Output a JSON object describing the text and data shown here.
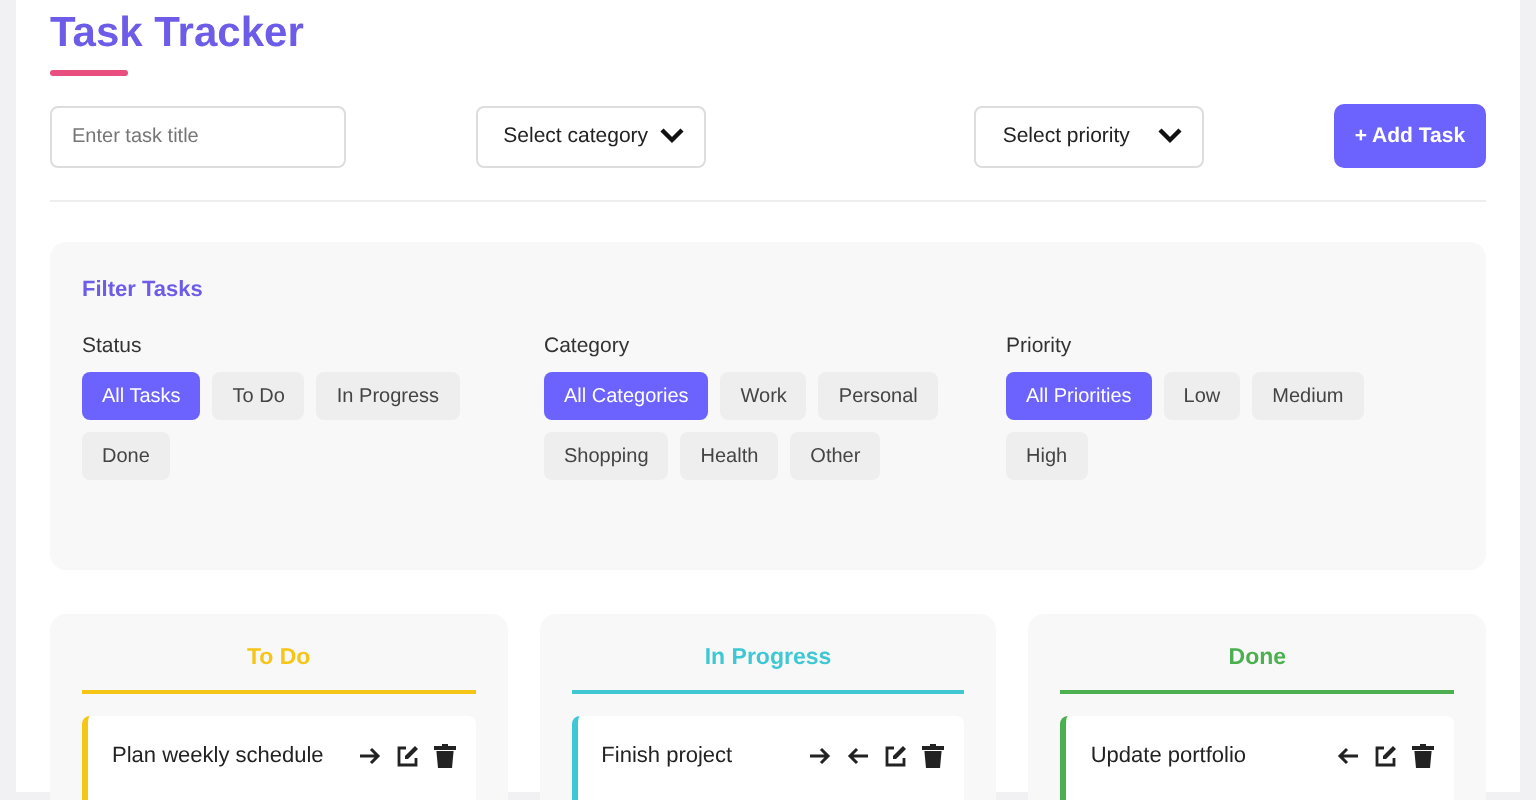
{
  "title": "Task Tracker",
  "form": {
    "title_placeholder": "Enter task title",
    "category": "Select category",
    "priority": "Select priority",
    "add_button": "+ Add Task"
  },
  "filters": {
    "heading": "Filter Tasks",
    "groups": [
      {
        "label": "Status",
        "options": [
          {
            "label": "All Tasks",
            "selected": true
          },
          {
            "label": "To Do",
            "selected": false
          },
          {
            "label": "In Progress",
            "selected": false
          },
          {
            "label": "Done",
            "selected": false
          }
        ]
      },
      {
        "label": "Category",
        "options": [
          {
            "label": "All Categories",
            "selected": true
          },
          {
            "label": "Work",
            "selected": false
          },
          {
            "label": "Personal",
            "selected": false
          },
          {
            "label": "Shopping",
            "selected": false
          },
          {
            "label": "Health",
            "selected": false
          },
          {
            "label": "Other",
            "selected": false
          }
        ]
      },
      {
        "label": "Priority",
        "options": [
          {
            "label": "All Priorities",
            "selected": true
          },
          {
            "label": "Low",
            "selected": false
          },
          {
            "label": "Medium",
            "selected": false
          },
          {
            "label": "High",
            "selected": false
          }
        ]
      }
    ]
  },
  "columns": [
    {
      "title": "To Do",
      "color": "#f5c518",
      "tasks": [
        {
          "title": "Plan weekly schedule",
          "actions": [
            {
              "kind": "right"
            },
            {
              "kind": "edit"
            },
            {
              "kind": "delete"
            }
          ]
        }
      ]
    },
    {
      "title": "In Progress",
      "color": "#3fc8d4",
      "tasks": [
        {
          "title": "Finish project",
          "actions": [
            {
              "kind": "right"
            },
            {
              "kind": "left"
            },
            {
              "kind": "edit"
            },
            {
              "kind": "delete"
            }
          ]
        }
      ]
    },
    {
      "title": "Done",
      "color": "#4caf50",
      "tasks": [
        {
          "title": "Update portfolio",
          "actions": [
            {
              "kind": "left"
            },
            {
              "kind": "edit"
            },
            {
              "kind": "delete"
            }
          ]
        }
      ]
    }
  ]
}
